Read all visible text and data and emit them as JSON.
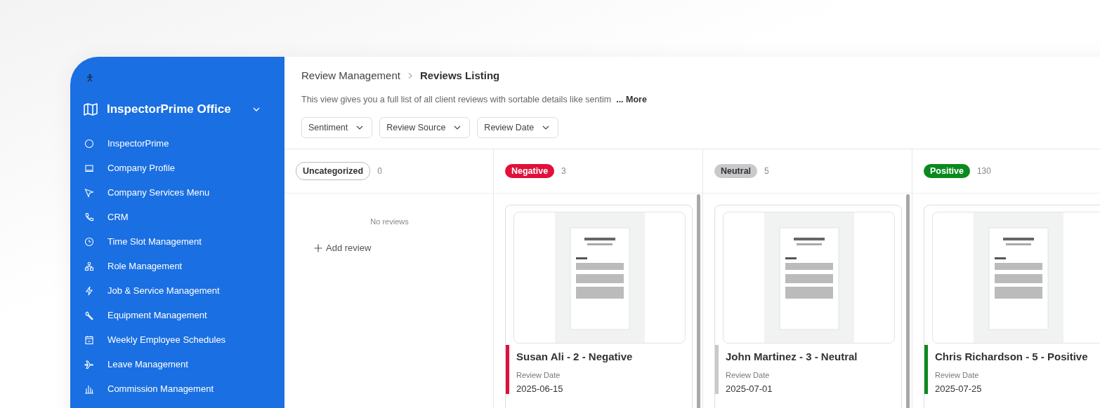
{
  "sidebar": {
    "title": "InspectorPrime Office",
    "items": [
      {
        "label": "InspectorPrime"
      },
      {
        "label": "Company Profile"
      },
      {
        "label": "Company Services Menu"
      },
      {
        "label": "CRM"
      },
      {
        "label": "Time Slot Management"
      },
      {
        "label": "Role Management"
      },
      {
        "label": "Job & Service Management"
      },
      {
        "label": "Equipment Management"
      },
      {
        "label": "Weekly Employee Schedules"
      },
      {
        "label": "Leave Management"
      },
      {
        "label": "Commission Management"
      }
    ]
  },
  "breadcrumb": {
    "parent": "Review Management",
    "current": "Reviews Listing"
  },
  "description": {
    "text": "This view gives you a full list of all client reviews with sortable details like sentim",
    "more": "... More"
  },
  "filters": [
    "Sentiment",
    "Review Source",
    "Review Date"
  ],
  "columns": [
    {
      "label": "Uncategorized",
      "kind": "outline",
      "count": "0",
      "empty_text": "No reviews",
      "add_label": "Add review"
    },
    {
      "label": "Negative",
      "kind": "filled",
      "color": "#e0103a",
      "count": "3",
      "cards": [
        {
          "kind": "picture",
          "title": "Susan Ali - 2 - Negative",
          "date_label": "Review Date",
          "date": "2025-06-15"
        }
      ]
    },
    {
      "label": "Neutral",
      "kind": "filled",
      "color": "#c9c9cc",
      "count": "5",
      "cards": [
        {
          "kind": "picture",
          "title": "John Martinez - 3 - Neutral",
          "date_label": "Review Date",
          "date": "2025-07-01"
        }
      ]
    },
    {
      "label": "Positive",
      "kind": "filled",
      "color": "#0a8a1e",
      "count": "130",
      "cards": [
        {
          "kind": "picture",
          "title": "Chris Richardson - 5 - Positive",
          "date_label": "Review Date",
          "date": "2025-07-25"
        }
      ]
    }
  ]
}
